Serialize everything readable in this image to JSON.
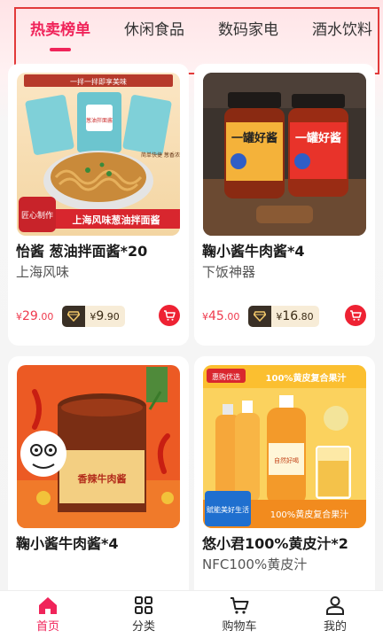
{
  "tabs": [
    {
      "label": "热卖榜单",
      "active": true
    },
    {
      "label": "休闲食品",
      "active": false
    },
    {
      "label": "数码家电",
      "active": false
    },
    {
      "label": "酒水饮料",
      "active": false
    }
  ],
  "products": [
    {
      "name": "怡酱 葱油拌面酱*20",
      "subtitle": "上海风味",
      "price_symbol": "¥",
      "price_int": "29",
      "price_dec": ".00",
      "member_symbol": "¥",
      "member_int": "9",
      "member_dec": ".90",
      "image_text": {
        "top_banner": "一拌一拌即享美味",
        "pack_label": "葱油拌面酱",
        "badge": "匠心制作",
        "bottom": "上海风味葱油拌面酱",
        "note": "简单快捷 葱香浓郁"
      }
    },
    {
      "name": "鞠小酱牛肉酱*4",
      "subtitle": "下饭神器",
      "price_symbol": "¥",
      "price_int": "45",
      "price_dec": ".00",
      "member_symbol": "¥",
      "member_int": "16",
      "member_dec": ".80",
      "image_text": {
        "jar_label": "一罐好酱"
      }
    },
    {
      "name": "鞠小酱牛肉酱*4",
      "subtitle": "",
      "image_text": {
        "jar_label": "香辣牛肉酱"
      }
    },
    {
      "name": "悠小君100%黄皮汁*2",
      "subtitle": "NFC100%黄皮汁",
      "image_text": {
        "corner": "惠购优选",
        "headline": "100%黄皮复合果汁",
        "bottle": "自然好喝",
        "slogan": "赋能美好生活",
        "bottom": "100%黄皮复合果汁"
      }
    }
  ],
  "bottom_nav": [
    {
      "label": "首页",
      "icon": "home-icon",
      "active": true
    },
    {
      "label": "分类",
      "icon": "grid-icon",
      "active": false
    },
    {
      "label": "购物车",
      "icon": "cart-icon",
      "active": false
    },
    {
      "label": "我的",
      "icon": "user-icon",
      "active": false
    }
  ],
  "colors": {
    "accent": "#f0245a",
    "price": "#ef3a4d",
    "cart_button": "#ee2233",
    "member_badge_bg": "#f7ecd7",
    "member_badge_icon": "#3a3026"
  }
}
